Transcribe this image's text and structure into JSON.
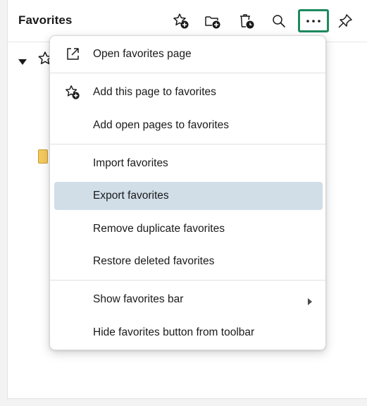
{
  "panel": {
    "title": "Favorites",
    "toolbar": [
      {
        "name": "add-page-to-favorites-button",
        "icon": "star-plus-icon"
      },
      {
        "name": "add-folder-button",
        "icon": "folder-plus-icon"
      },
      {
        "name": "deleted-favorites-button",
        "icon": "trash-clock-icon"
      },
      {
        "name": "search-favorites-button",
        "icon": "search-icon"
      },
      {
        "name": "more-options-button",
        "icon": "more-horizontal-icon",
        "active": true
      },
      {
        "name": "pin-button",
        "icon": "pin-icon"
      }
    ]
  },
  "menu": {
    "items": [
      {
        "label": "Open favorites page",
        "icon": "open-external-icon"
      },
      {
        "label": "Add this page to favorites",
        "icon": "star-plus-icon"
      },
      {
        "label": "Add open pages to favorites"
      },
      {
        "label": "Import favorites"
      },
      {
        "label": "Export favorites",
        "highlighted": true
      },
      {
        "label": "Remove duplicate favorites"
      },
      {
        "label": "Restore deleted favorites"
      },
      {
        "label": "Show favorites bar",
        "submenu": true
      },
      {
        "label": "Hide favorites button from toolbar"
      }
    ]
  },
  "colors": {
    "active_outline": "#1e8a5e",
    "highlight": "#d1dee8",
    "folder": "#f4c95d"
  }
}
